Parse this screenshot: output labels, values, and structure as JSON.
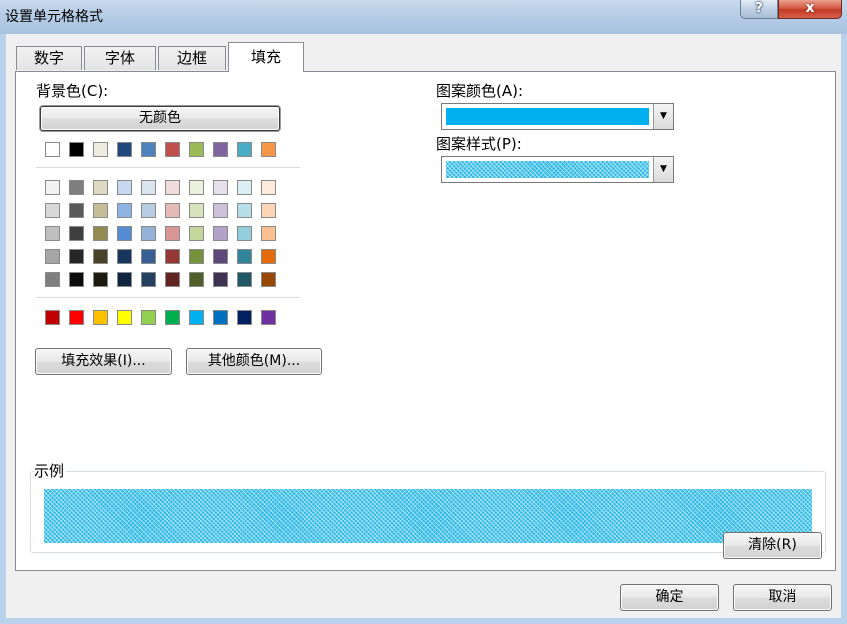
{
  "window": {
    "title": "设置单元格格式",
    "help_label": "?",
    "close_label": "x"
  },
  "tabs": [
    "数字",
    "字体",
    "边框",
    "填充"
  ],
  "fill": {
    "background_label": "背景色(C):",
    "no_color_label": "无颜色",
    "theme_row": [
      "#ffffff",
      "#000000",
      "#eeece1",
      "#1f497d",
      "#4f81bd",
      "#c0504d",
      "#9bbb59",
      "#8064a2",
      "#4bacc6",
      "#f79646"
    ],
    "shade_rows": [
      [
        "#f2f2f2",
        "#7f7f7f",
        "#ddd9c3",
        "#c6d9f0",
        "#dbe5f1",
        "#f2dcdb",
        "#ebf1dd",
        "#e5e0ec",
        "#dbeef3",
        "#fdeada"
      ],
      [
        "#d8d8d8",
        "#595959",
        "#c4bd97",
        "#8db3e2",
        "#b8cce4",
        "#e5b9b7",
        "#d7e3bc",
        "#ccc1d9",
        "#b7dde8",
        "#fbd5b5"
      ],
      [
        "#bfbfbf",
        "#3f3f3f",
        "#938953",
        "#548dd4",
        "#95b3d7",
        "#d99694",
        "#c3d69b",
        "#b2a2c7",
        "#92cddc",
        "#fac08f"
      ],
      [
        "#a5a5a5",
        "#262626",
        "#494429",
        "#17365d",
        "#366092",
        "#953734",
        "#76923c",
        "#5f497a",
        "#31859b",
        "#e36c09"
      ],
      [
        "#7f7f7f",
        "#0c0c0c",
        "#1d1b10",
        "#0f243e",
        "#244061",
        "#632423",
        "#4f6128",
        "#3f3151",
        "#205867",
        "#974806"
      ]
    ],
    "standard_row": [
      "#c00000",
      "#ff0000",
      "#ffc000",
      "#ffff00",
      "#92d050",
      "#00b050",
      "#00b0f0",
      "#0070c0",
      "#002060",
      "#7030a0"
    ],
    "fill_effects_label": "填充效果(I)...",
    "more_colors_label": "其他颜色(M)...",
    "pattern_color_label": "图案颜色(A):",
    "pattern_color_value": "#00b0f0",
    "pattern_style_label": "图案样式(P):",
    "sample_label": "示例",
    "clear_label": "清除(R)"
  },
  "footer": {
    "ok_label": "确定",
    "cancel_label": "取消"
  }
}
